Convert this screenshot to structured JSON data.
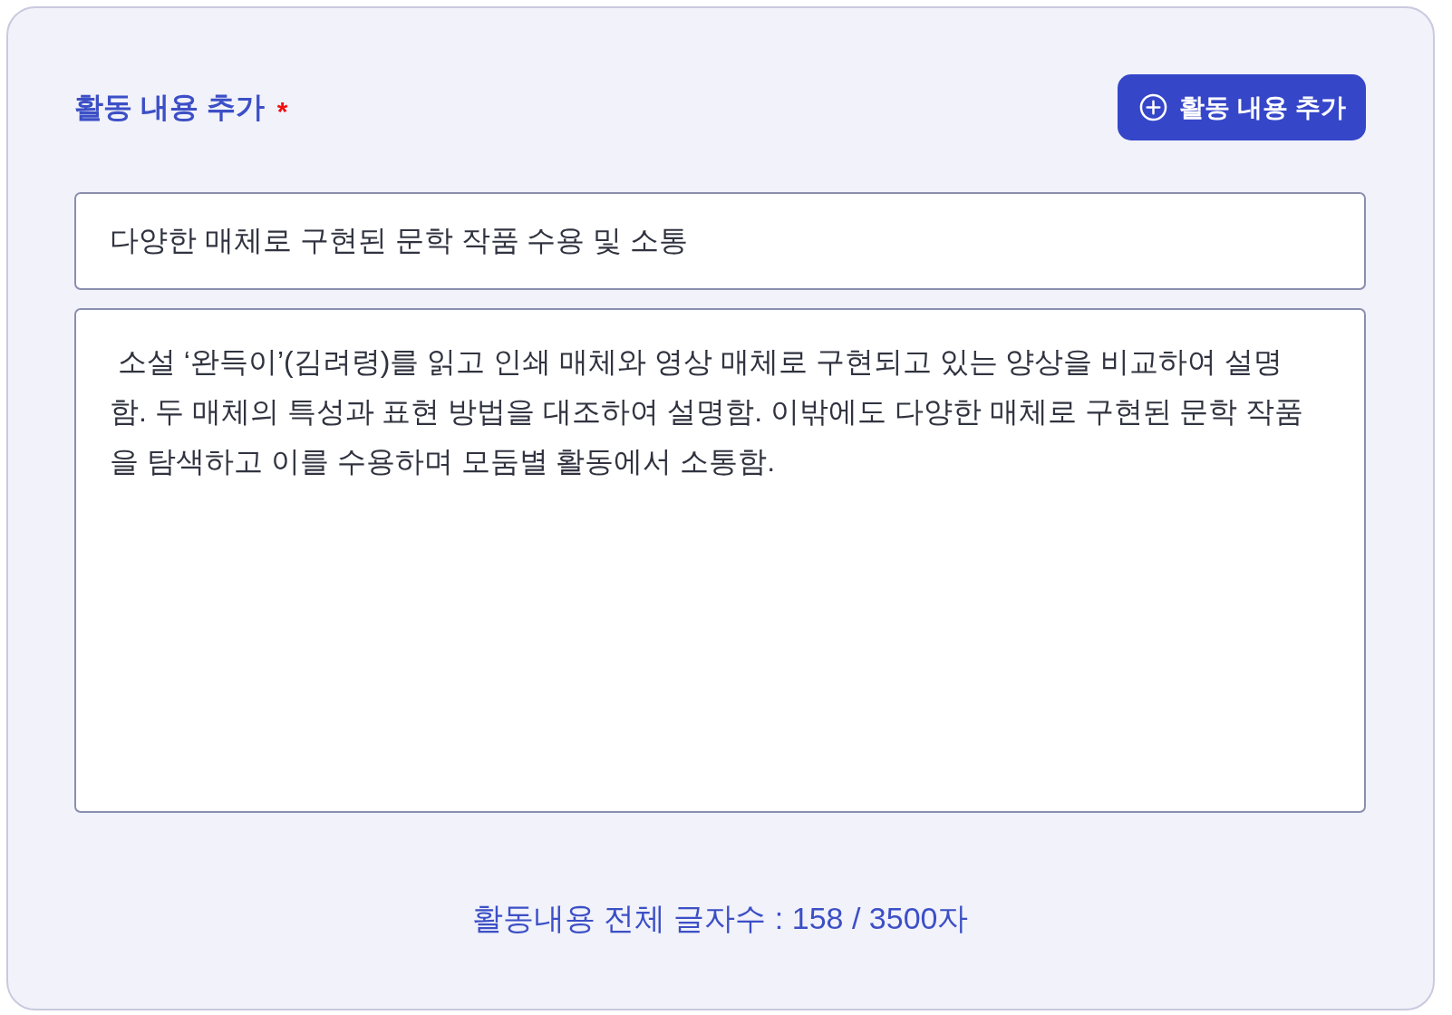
{
  "section": {
    "title": "활동 내용 추가",
    "required_mark": "*"
  },
  "add_button": {
    "label": "활동 내용 추가"
  },
  "title_field": {
    "value": "다양한 매체로 구현된 문학 작품 수용 및 소통"
  },
  "content_field": {
    "value": " 소설 ‘완득이’(김려령)를 읽고 인쇄 매체와 영상 매체로 구현되고 있는 양상을 비교하여 설명함. 두 매체의 특성과 표현 방법을 대조하여 설명함. 이밖에도 다양한 매체로 구현된 문학 작품을 탐색하고 이를 수용하며 모둠별 활동에서 소통함."
  },
  "char_count": "활동내용 전체 글자수 : 158 / 3500자"
}
